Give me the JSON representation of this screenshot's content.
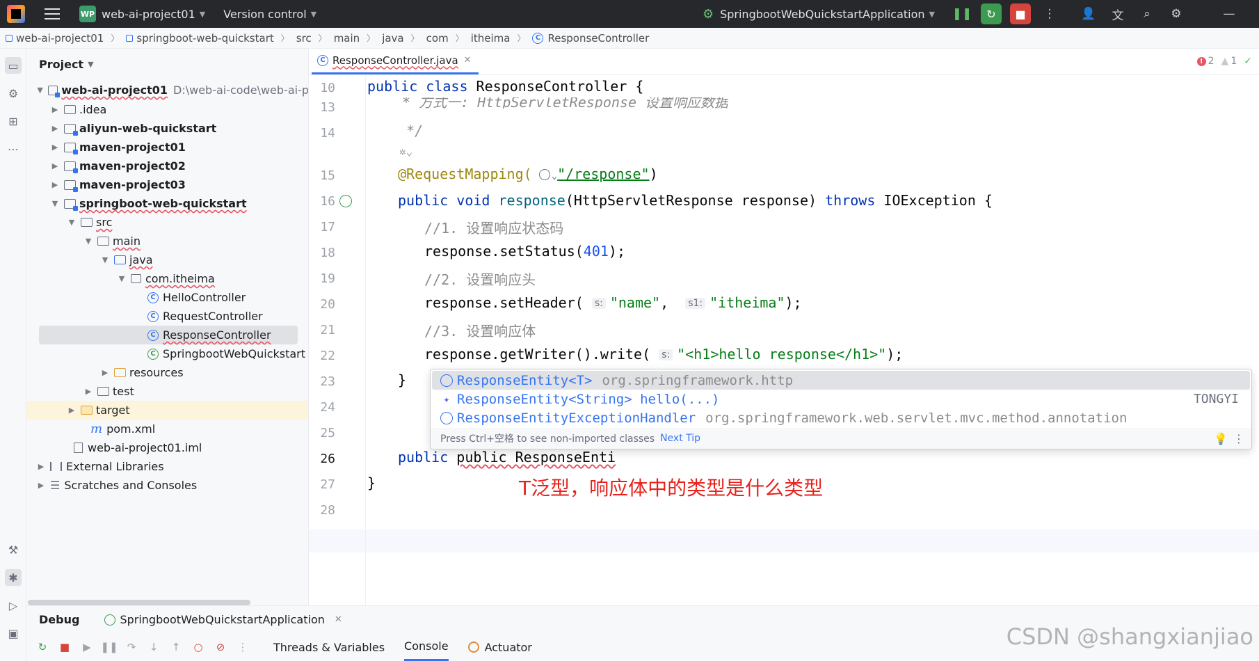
{
  "titlebar": {
    "project_badge": "WP",
    "project_name": "web-ai-project01",
    "vcs": "Version control",
    "run_config": "SpringbootWebQuickstartApplication"
  },
  "breadcrumb": [
    "web-ai-project01",
    "springboot-web-quickstart",
    "src",
    "main",
    "java",
    "com",
    "itheima",
    "ResponseController"
  ],
  "project": {
    "header": "Project",
    "root_name": "web-ai-project01",
    "root_path": "D:\\web-ai-code\\web-ai-p",
    "items": [
      {
        "label": ".idea"
      },
      {
        "label": "aliyun-web-quickstart"
      },
      {
        "label": "maven-project01"
      },
      {
        "label": "maven-project02"
      },
      {
        "label": "maven-project03"
      },
      {
        "label": "springboot-web-quickstart"
      },
      {
        "label": "src"
      },
      {
        "label": "main"
      },
      {
        "label": "java"
      },
      {
        "label": "com.itheima"
      },
      {
        "label": "HelloController"
      },
      {
        "label": "RequestController"
      },
      {
        "label": "ResponseController"
      },
      {
        "label": "SpringbootWebQuickstart"
      },
      {
        "label": "resources"
      },
      {
        "label": "test"
      },
      {
        "label": "target"
      },
      {
        "label": "pom.xml"
      },
      {
        "label": "web-ai-project01.iml"
      },
      {
        "label": "External Libraries"
      },
      {
        "label": "Scratches and Consoles"
      }
    ]
  },
  "editor": {
    "tab": "ResponseController.java",
    "errors": "2",
    "warnings": "1",
    "line_numbers": [
      "10",
      "13",
      "14",
      "15",
      "16",
      "17",
      "18",
      "19",
      "20",
      "21",
      "22",
      "23",
      "24",
      "25",
      "26",
      "27",
      "28"
    ],
    "comment_1": "//1. 设置响应状态码",
    "comment_2": "//2. 设置响应头",
    "comment_3": "//3. 设置响应体",
    "mapping_path": "/response",
    "status_value": "401",
    "header_name": "\"name\"",
    "header_value": "\"itheima\"",
    "write_value": "\"<h1>hello response</h1>\"",
    "hint_s": "s:",
    "hint_s1": "s1:",
    "sticky_comment": " * 方式一: HttpServletResponse 设置响应数据",
    "typing": "public ResponseEnti"
  },
  "completion": {
    "items": [
      {
        "name": "ResponseEntity<T>",
        "detail": "org.springframework.http",
        "right": ""
      },
      {
        "name": "ResponseEntity<String> hello(...)",
        "detail": "",
        "right": "TONGYI"
      },
      {
        "name": "ResponseEntityExceptionHandler",
        "detail": "org.springframework.web.servlet.mvc.method.annotation",
        "right": ""
      }
    ],
    "footer": "Press Ctrl+空格 to see non-imported classes",
    "next_tip": "Next Tip"
  },
  "overlay_text": "T泛型，响应体中的类型是什么类型",
  "debug": {
    "title": "Debug",
    "session": "SpringbootWebQuickstartApplication",
    "tabs": [
      "Threads & Variables",
      "Console",
      "Actuator"
    ]
  },
  "watermark": "CSDN @shangxianjiao"
}
